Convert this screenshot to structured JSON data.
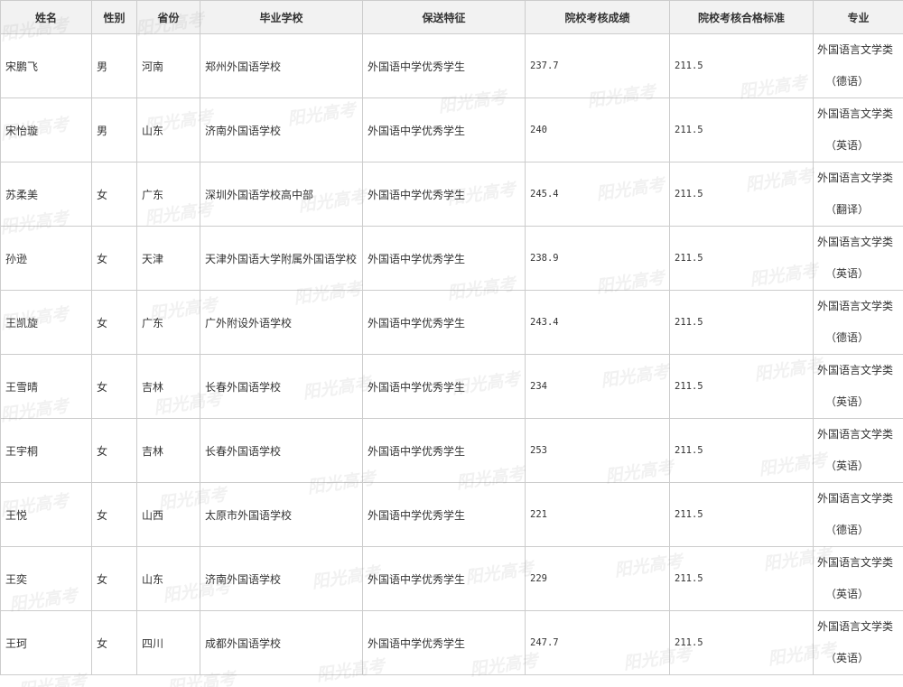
{
  "table": {
    "headers": [
      "姓名",
      "性别",
      "省份",
      "毕业学校",
      "保送特征",
      "院校考核成绩",
      "院校考核合格标准",
      "专业"
    ],
    "rows": [
      {
        "name": "宋鹏飞",
        "gender": "男",
        "province": "河南",
        "school": "郑州外国语学校",
        "feature": "外国语中学优秀学生",
        "score": "237.7",
        "standard": "211.5",
        "major": "外国语言文学类",
        "direction": "（德语）"
      },
      {
        "name": "宋怡璇",
        "gender": "男",
        "province": "山东",
        "school": "济南外国语学校",
        "feature": "外国语中学优秀学生",
        "score": "240",
        "standard": "211.5",
        "major": "外国语言文学类",
        "direction": "（英语）"
      },
      {
        "name": "苏柔美",
        "gender": "女",
        "province": "广东",
        "school": "深圳外国语学校高中部",
        "feature": "外国语中学优秀学生",
        "score": "245.4",
        "standard": "211.5",
        "major": "外国语言文学类",
        "direction": "（翻译）"
      },
      {
        "name": "孙逊",
        "gender": "女",
        "province": "天津",
        "school": "天津外国语大学附属外国语学校",
        "feature": "外国语中学优秀学生",
        "score": "238.9",
        "standard": "211.5",
        "major": "外国语言文学类",
        "direction": "（英语）"
      },
      {
        "name": "王凯旋",
        "gender": "女",
        "province": "广东",
        "school": "广外附设外语学校",
        "feature": "外国语中学优秀学生",
        "score": "243.4",
        "standard": "211.5",
        "major": "外国语言文学类",
        "direction": "（德语）"
      },
      {
        "name": "王雪晴",
        "gender": "女",
        "province": "吉林",
        "school": "长春外国语学校",
        "feature": "外国语中学优秀学生",
        "score": "234",
        "standard": "211.5",
        "major": "外国语言文学类",
        "direction": "（英语）"
      },
      {
        "name": "王宇桐",
        "gender": "女",
        "province": "吉林",
        "school": "长春外国语学校",
        "feature": "外国语中学优秀学生",
        "score": "253",
        "standard": "211.5",
        "major": "外国语言文学类",
        "direction": "（英语）"
      },
      {
        "name": "王悦",
        "gender": "女",
        "province": "山西",
        "school": "太原市外国语学校",
        "feature": "外国语中学优秀学生",
        "score": "221",
        "standard": "211.5",
        "major": "外国语言文学类",
        "direction": "（德语）"
      },
      {
        "name": "王奕",
        "gender": "女",
        "province": "山东",
        "school": "济南外国语学校",
        "feature": "外国语中学优秀学生",
        "score": "229",
        "standard": "211.5",
        "major": "外国语言文学类",
        "direction": "（英语）"
      },
      {
        "name": "王珂",
        "gender": "女",
        "province": "四川",
        "school": "成都外国语学校",
        "feature": "外国语中学优秀学生",
        "score": "247.7",
        "standard": "211.5",
        "major": "外国语言文学类",
        "direction": "（英语）"
      }
    ]
  },
  "watermark": {
    "text": "阳光高考"
  }
}
